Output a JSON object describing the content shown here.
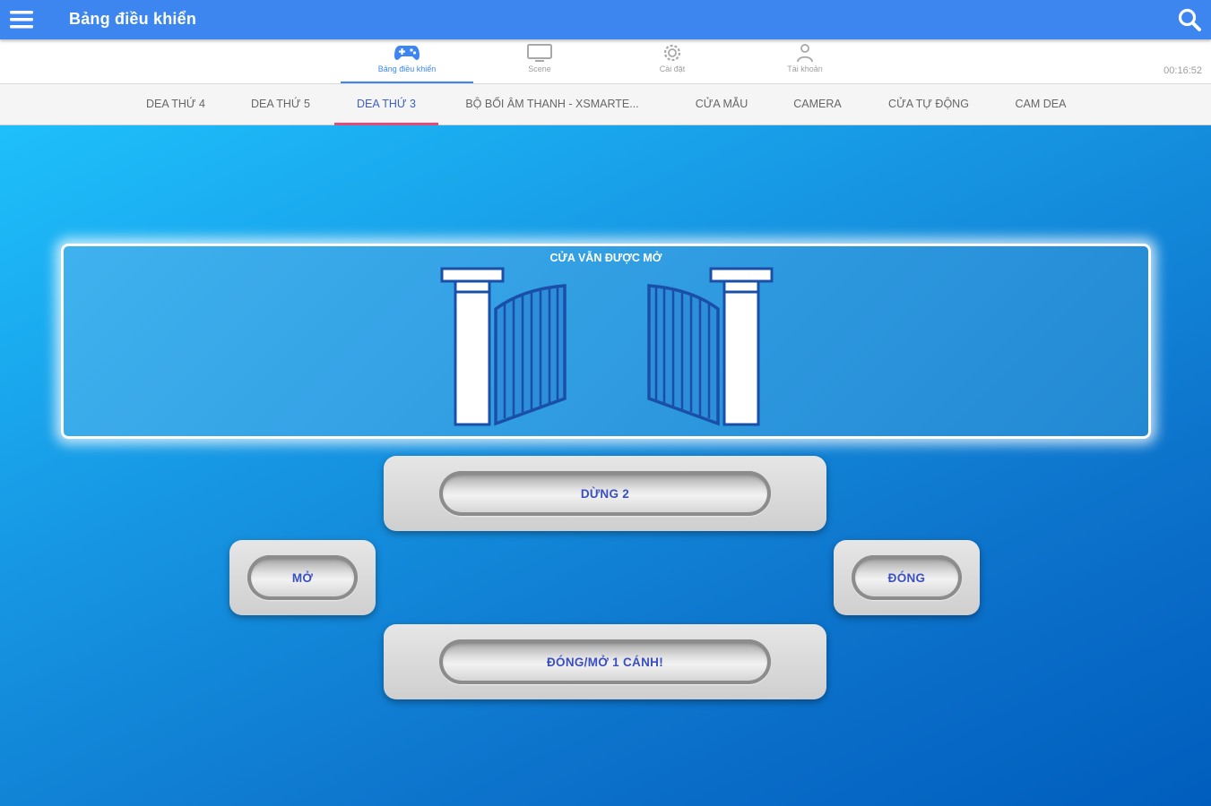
{
  "appbar": {
    "title": "Bảng điều khiển"
  },
  "icon_tabs": [
    {
      "label": "Bảng điều khiển",
      "icon": "gamepad-icon",
      "active": true
    },
    {
      "label": "Scene",
      "icon": "monitor-icon",
      "active": false
    },
    {
      "label": "Cài đặt",
      "icon": "gear-icon",
      "active": false
    },
    {
      "label": "Tài khoản",
      "icon": "user-icon",
      "active": false
    }
  ],
  "clock": "00:16:52",
  "text_tabs": [
    {
      "label": "DEA THỨ 4",
      "active": false
    },
    {
      "label": "DEA THỨ 5",
      "active": false
    },
    {
      "label": "DEA THỨ 3",
      "active": true
    },
    {
      "label": "BỘ BỐI ÂM THANH - XSMARTE...",
      "active": false
    },
    {
      "label": "CỬA MẪU",
      "active": false
    },
    {
      "label": "CAMERA",
      "active": false
    },
    {
      "label": "CỬA TỰ ĐỘNG",
      "active": false
    },
    {
      "label": "CAM DEA",
      "active": false
    }
  ],
  "gate": {
    "status": "CỬA VẪN ĐƯỢC MỞ"
  },
  "controls": {
    "stop": "DỪNG 2",
    "open": "MỞ",
    "close": "ĐÓNG",
    "single": "ĐÓNG/MỞ 1 CÁNH!"
  },
  "colors": {
    "appbar": "#3d86f0",
    "active_tab_underline": "#e64a7b",
    "button_text": "#3a4fc0",
    "gate_outline": "#1a4fa8"
  }
}
